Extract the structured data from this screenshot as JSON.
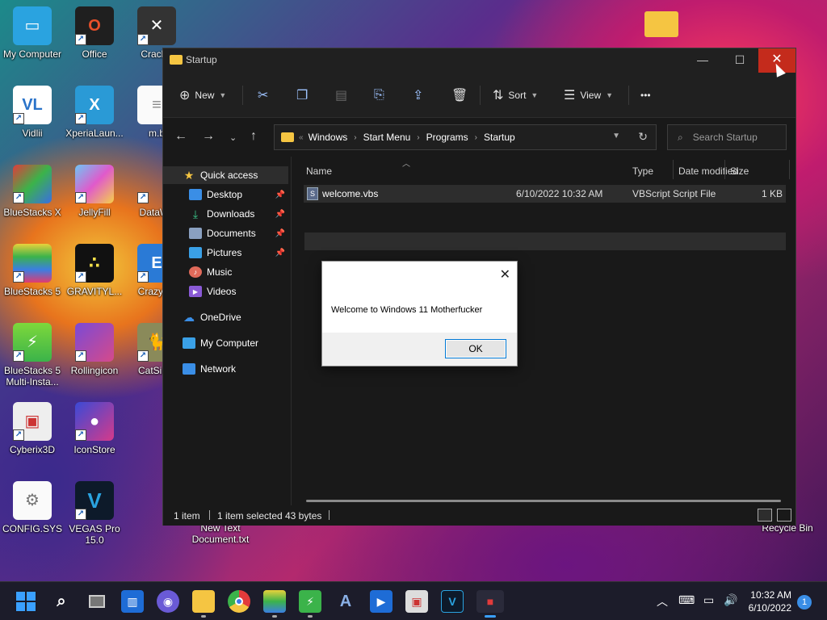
{
  "desktop": {
    "icons": [
      {
        "label": "My Computer",
        "icon": "computer-icon"
      },
      {
        "label": "Office",
        "icon": "office-icon"
      },
      {
        "label": "CrackS",
        "icon": "crack-icon"
      },
      {
        "label": "Vidlii",
        "icon": "vidlii-icon"
      },
      {
        "label": "XperiaLaun...",
        "icon": "xperia-icon"
      },
      {
        "label": "m.b",
        "icon": "text-file-icon"
      },
      {
        "label": "BlueStacks X",
        "icon": "bluestacks-x-icon"
      },
      {
        "label": "JellyFill",
        "icon": "jellyfill-icon"
      },
      {
        "label": "DataWa",
        "icon": "datawa-icon"
      },
      {
        "label": "BlueStacks 5",
        "icon": "bluestacks-icon"
      },
      {
        "label": "GRAVITYL...",
        "icon": "gravity-icon"
      },
      {
        "label": "Crazy Er",
        "icon": "crazy-icon"
      },
      {
        "label": "BlueStacks 5 Multi-Insta...",
        "icon": "bluestacks-multi-icon"
      },
      {
        "label": "Rollingicon",
        "icon": "rolling-icon"
      },
      {
        "label": "CatSimu",
        "icon": "cat-icon"
      },
      {
        "label": "Cyberix3D",
        "icon": "cyberix-icon"
      },
      {
        "label": "IconStore",
        "icon": "iconstore-icon"
      },
      {
        "label": "CONFIG.SYS",
        "icon": "config-icon"
      },
      {
        "label": "VEGAS Pro 15.0",
        "icon": "vegas-icon"
      },
      {
        "label": "New Text Document.txt",
        "icon": "text-file-icon"
      },
      {
        "label": "Recycle Bin",
        "icon": "recycle-bin-icon"
      }
    ]
  },
  "explorer": {
    "title": "Startup",
    "toolbar": {
      "new_label": "New",
      "sort_label": "Sort",
      "view_label": "View",
      "more_label": "•••"
    },
    "breadcrumb": [
      "Windows",
      "Start Menu",
      "Programs",
      "Startup"
    ],
    "search_placeholder": "Search Startup",
    "sidebar": {
      "quick_access": "Quick access",
      "desktop": "Desktop",
      "downloads": "Downloads",
      "documents": "Documents",
      "pictures": "Pictures",
      "music": "Music",
      "videos": "Videos",
      "onedrive": "OneDrive",
      "my_computer": "My Computer",
      "network": "Network"
    },
    "columns": {
      "name": "Name",
      "date": "Date modified",
      "type": "Type",
      "size": "Size"
    },
    "files": [
      {
        "name": "welcome.vbs",
        "date": "6/10/2022 10:32 AM",
        "type": "VBScript Script File",
        "size": "1 KB"
      }
    ],
    "status": {
      "count": "1 item",
      "selected": "1 item selected",
      "bytes": "43 bytes"
    }
  },
  "dialog": {
    "message": "Welcome to Windows 11 Motherfucker",
    "ok_label": "OK"
  },
  "taskbar": {
    "time": "10:32 AM",
    "date": "6/10/2022",
    "notifications": "1"
  },
  "colors": {
    "close_red": "#c42b1c",
    "accent": "#0078d4",
    "folder_yellow": "#f5c542"
  }
}
